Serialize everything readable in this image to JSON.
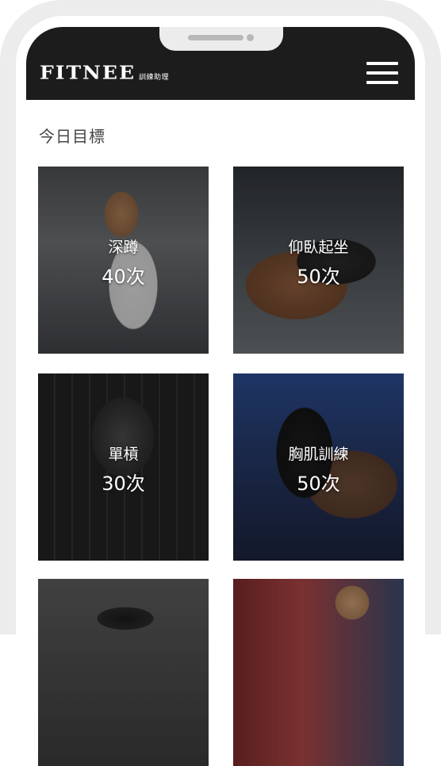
{
  "header": {
    "brand": "FITNEE",
    "tagline": "訓練助理",
    "menu_icon": "hamburger-menu-icon"
  },
  "main": {
    "title": "今日目標",
    "cards": [
      {
        "name": "深蹲",
        "count": "40次"
      },
      {
        "name": "仰臥起坐",
        "count": "50次"
      },
      {
        "name": "單槓",
        "count": "30次"
      },
      {
        "name": "胸肌訓練",
        "count": "50次"
      },
      {
        "name": "",
        "count": ""
      },
      {
        "name": "",
        "count": ""
      }
    ]
  },
  "colors": {
    "header_bg": "#1c1c1c",
    "frame": "#ececec",
    "text_title": "#444444"
  }
}
